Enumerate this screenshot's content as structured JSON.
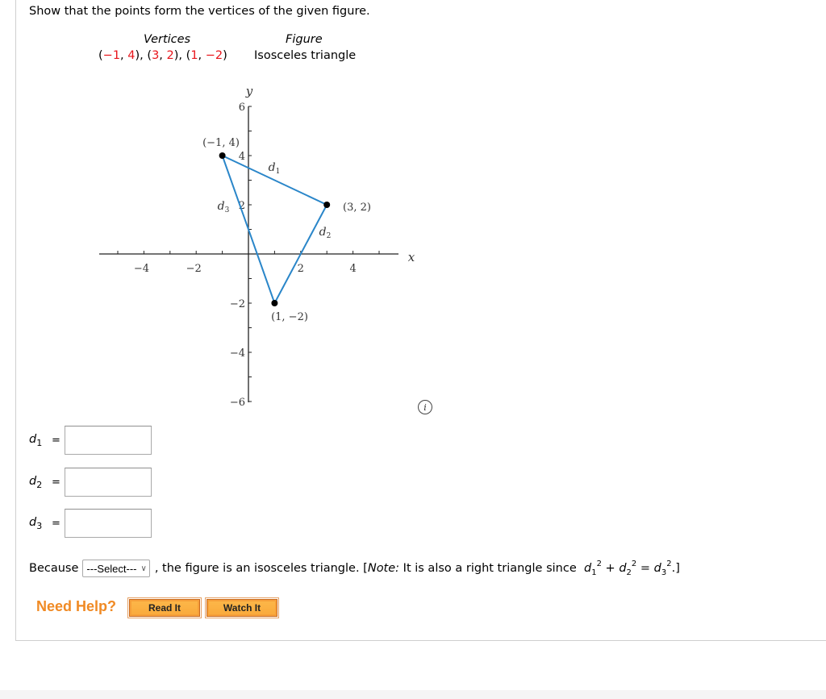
{
  "prompt": "Show that the points form the vertices of the given figure.",
  "table": {
    "vertices_header": "Vertices",
    "figure_header": "Figure",
    "vertices": [
      {
        "open": "(",
        "x": "−1",
        "sep": ", ",
        "y": "4",
        "close": ")"
      },
      {
        "open": "(",
        "x": "3",
        "sep": ", ",
        "y": "2",
        "close": ")"
      },
      {
        "open": "(",
        "x": "1",
        "sep": ", ",
        "y": "−2",
        "close": ")"
      }
    ],
    "figure": "Isosceles triangle"
  },
  "graph": {
    "x_axis_label": "x",
    "y_axis_label": "y",
    "x_range": [
      -5.5,
      5.9
    ],
    "y_range": [
      -6,
      6.5
    ],
    "x_ticks": [
      -5,
      -4,
      -3,
      -2,
      -1,
      1,
      2,
      3,
      4,
      5
    ],
    "x_tick_labels": [
      {
        "value": -4,
        "text": "−4"
      },
      {
        "value": -2,
        "text": "−2"
      },
      {
        "value": 2,
        "text": "2"
      },
      {
        "value": 4,
        "text": "4"
      }
    ],
    "y_ticks": [
      -6,
      -5,
      -4,
      -3,
      -2,
      -1,
      1,
      2,
      3,
      4,
      5,
      6
    ],
    "y_tick_labels": [
      {
        "value": 6,
        "text": "6"
      },
      {
        "value": 4,
        "text": "4"
      },
      {
        "value": 2,
        "text": "2"
      },
      {
        "value": -2,
        "text": "−2"
      },
      {
        "value": -4,
        "text": "−4"
      },
      {
        "value": -6,
        "text": "−6"
      }
    ],
    "points": [
      {
        "x": -1,
        "y": 4,
        "label": "(−1, 4)"
      },
      {
        "x": 3,
        "y": 2,
        "label": "(3, 2)"
      },
      {
        "x": 1,
        "y": -2,
        "label": "(1, −2)"
      }
    ],
    "segments": [
      {
        "name": "d",
        "sub": "1",
        "from": 0,
        "to": 1
      },
      {
        "name": "d",
        "sub": "2",
        "from": 1,
        "to": 2
      },
      {
        "name": "d",
        "sub": "3",
        "from": 2,
        "to": 0
      }
    ],
    "line_color": "#2a86c9",
    "point_color": "#000000"
  },
  "answers": [
    {
      "var": "d",
      "sub": "1",
      "eq": "=",
      "value": ""
    },
    {
      "var": "d",
      "sub": "2",
      "eq": "=",
      "value": ""
    },
    {
      "var": "d",
      "sub": "3",
      "eq": "=",
      "value": ""
    }
  ],
  "because": {
    "prefix": "Because",
    "select_value": "---Select---",
    "middle": ", the figure is an isosceles triangle. [",
    "note_label": "Note:",
    "note_text": " It is also a right triangle since ",
    "eq": {
      "t1": "d",
      "s1": "1",
      "plus": " + ",
      "t2": "d",
      "s2": "2",
      "equals": " = ",
      "t3": "d",
      "s3": "3",
      "exp": "2",
      "end": ".]"
    }
  },
  "help": {
    "label": "Need Help?",
    "read_button": "Read It",
    "watch_button": "Watch It"
  },
  "info_icon": "i"
}
